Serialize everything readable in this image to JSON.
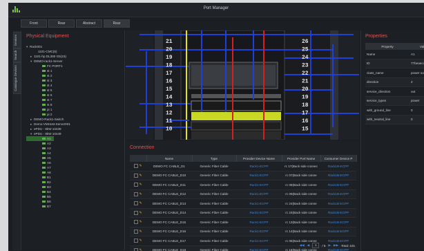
{
  "app": {
    "title": "Port Manager"
  },
  "view_tabs": [
    "Front",
    "Rear",
    "Abstract",
    "Rear"
  ],
  "side_tabs": [
    "Devices",
    "Search",
    "Catalogue Devices"
  ],
  "left_panel": {
    "heading": "Physical Equipment",
    "tree": [
      {
        "label": "Rack001",
        "toggle": "▾",
        "indent": 0,
        "sq": false
      },
      {
        "label": "1101-CMC(6)",
        "toggle": "",
        "indent": 2,
        "sq": false
      },
      {
        "label": "1101-hp DL380 G5(15)",
        "toggle": "▸",
        "indent": 1,
        "sq": false
      },
      {
        "label": "DEMO-rack1-Server",
        "toggle": "▾",
        "indent": 1,
        "sq": false
      },
      {
        "label": "FC PORT1",
        "toggle": "",
        "indent": 3,
        "sq": true
      },
      {
        "label": "st 1",
        "toggle": "",
        "indent": 3,
        "sq": true
      },
      {
        "label": "st 2",
        "toggle": "",
        "indent": 3,
        "sq": true
      },
      {
        "label": "st 3",
        "toggle": "",
        "indent": 3,
        "sq": true
      },
      {
        "label": "st 4",
        "toggle": "",
        "indent": 3,
        "sq": true
      },
      {
        "label": "st 5",
        "toggle": "",
        "indent": 3,
        "sq": true
      },
      {
        "label": "st 6",
        "toggle": "",
        "indent": 3,
        "sq": true
      },
      {
        "label": "st 7",
        "toggle": "",
        "indent": 3,
        "sq": true
      },
      {
        "label": "st 8",
        "toggle": "",
        "indent": 3,
        "sq": true
      },
      {
        "label": "pi 1",
        "toggle": "",
        "indent": 3,
        "sq": true
      },
      {
        "label": "pi 2",
        "toggle": "",
        "indent": 3,
        "sq": true
      },
      {
        "label": "DEMO-Rack1-Switch",
        "toggle": "▸",
        "indent": 1,
        "sq": false
      },
      {
        "label": "Demo-VMHost-Server001",
        "toggle": "▸",
        "indent": 1,
        "sq": false
      },
      {
        "label": "ePDU - 8kW 10439",
        "toggle": "▸",
        "indent": 1,
        "sq": false
      },
      {
        "label": "ePDU - 8kW 10449",
        "toggle": "▾",
        "indent": 1,
        "sq": false
      },
      {
        "label": "A1",
        "toggle": "",
        "indent": 3,
        "sq": true,
        "selected": true
      },
      {
        "label": "A2",
        "toggle": "",
        "indent": 3,
        "sq": true
      },
      {
        "label": "A3",
        "toggle": "",
        "indent": 3,
        "sq": true
      },
      {
        "label": "A4",
        "toggle": "",
        "indent": 3,
        "sq": true
      },
      {
        "label": "A5",
        "toggle": "",
        "indent": 3,
        "sq": true
      },
      {
        "label": "A6",
        "toggle": "",
        "indent": 3,
        "sq": true
      },
      {
        "label": "A7",
        "toggle": "",
        "indent": 3,
        "sq": true
      },
      {
        "label": "A8",
        "toggle": "",
        "indent": 3,
        "sq": true
      },
      {
        "label": "B1",
        "toggle": "",
        "indent": 3,
        "sq": true
      },
      {
        "label": "B2",
        "toggle": "",
        "indent": 3,
        "sq": true
      },
      {
        "label": "B3",
        "toggle": "",
        "indent": 3,
        "sq": true
      },
      {
        "label": "B4",
        "toggle": "",
        "indent": 3,
        "sq": true
      },
      {
        "label": "B5",
        "toggle": "",
        "indent": 3,
        "sq": true
      },
      {
        "label": "B6",
        "toggle": "",
        "indent": 3,
        "sq": true
      },
      {
        "label": "B7",
        "toggle": "",
        "indent": 3,
        "sq": true
      }
    ]
  },
  "rack": {
    "left_units": [
      "21",
      "20",
      "19",
      "18",
      "17",
      "16",
      "15",
      "14",
      "13",
      "12",
      "11",
      "10"
    ],
    "right_units": [
      "26",
      "25",
      "24",
      "23",
      "22",
      "21",
      "20",
      "19",
      "18",
      "17",
      "16",
      "15"
    ]
  },
  "connection": {
    "heading": "Connection",
    "columns": [
      "",
      "Name",
      "Type",
      "Provider Device Name",
      "Provider Port Name",
      "Consumer Device P"
    ],
    "rows": [
      [
        "DEMO FC CABLE_D1",
        "Generic Fiber Cable",
        "Rack1-ECPP",
        "rc 17(Back side connec",
        "Rack1B-ECPP"
      ],
      [
        "DEMO FC CABLE_D10",
        "Generic Fiber Cable",
        "Rack1-ECPP",
        "rc 07(Back side conne",
        "Rack1B-ECPP"
      ],
      [
        "DEMO FC CABLE_D11",
        "Generic Fiber Cable",
        "Rack1-ECPP",
        "rc 08(Back side conne",
        "Rack1B-ECPP"
      ],
      [
        "DEMO FC CABLE_D12",
        "Generic Fiber Cable",
        "Rack1-ECPP",
        "rc 09(Back side conne",
        "Rack1B-ECPP"
      ],
      [
        "DEMO FC CABLE_D13",
        "Generic Fiber Cable",
        "Rack1-ECPP",
        "rc 24(Back side conne",
        "Rack1B-ECPP"
      ],
      [
        "DEMO FC CABLE_D14",
        "Generic Fiber Cable",
        "Rack1-ECPP",
        "rc 24(Back side conne",
        "Rack1B-ECPP"
      ],
      [
        "DEMO FC CABLE_D15",
        "Generic Fiber Cable",
        "Rack1-ECPP",
        "rc 13(Back side conne",
        "Rack1B-ECPP"
      ],
      [
        "DEMO FC CABLE_D16",
        "Generic Fiber Cable",
        "Rack1-ECPP",
        "rc 14(Back side conne",
        "Rack1B-ECPP"
      ],
      [
        "DEMO FC CABLE_D17",
        "Generic Fiber Cable",
        "Rack1-ECPP",
        "rc 05(Back side conne",
        "Rack1B-ECPP"
      ],
      [
        "DEMO FC CABLE_D18",
        "Generic Fiber Cable",
        "Rack1-ECPP",
        "rc 16(Back side conne",
        "Rack1B-ECPP"
      ]
    ],
    "pager": {
      "page": "1",
      "of": "/ 6",
      "total": "Total: 101"
    }
  },
  "properties": {
    "heading": "Properties",
    "columns": [
      "Property",
      "Val"
    ],
    "rows": [
      [
        "Name",
        "A1"
      ],
      [
        "ID",
        "77beaec4..."
      ],
      [
        "class_name",
        "power outl"
      ],
      [
        "direction",
        "2"
      ],
      [
        "service_direction",
        "out"
      ],
      [
        "service_types",
        "power"
      ],
      [
        "with_ground_line",
        "0"
      ],
      [
        "with_neutral_line",
        "0"
      ]
    ]
  },
  "colors": {
    "accent_red": "#e25555",
    "link_blue": "#3f86d8",
    "tree_green": "#58b53f",
    "cable_blue": "#1f3fd6",
    "cable_red": "#d62020",
    "cable_yellow": "#e5e312"
  }
}
